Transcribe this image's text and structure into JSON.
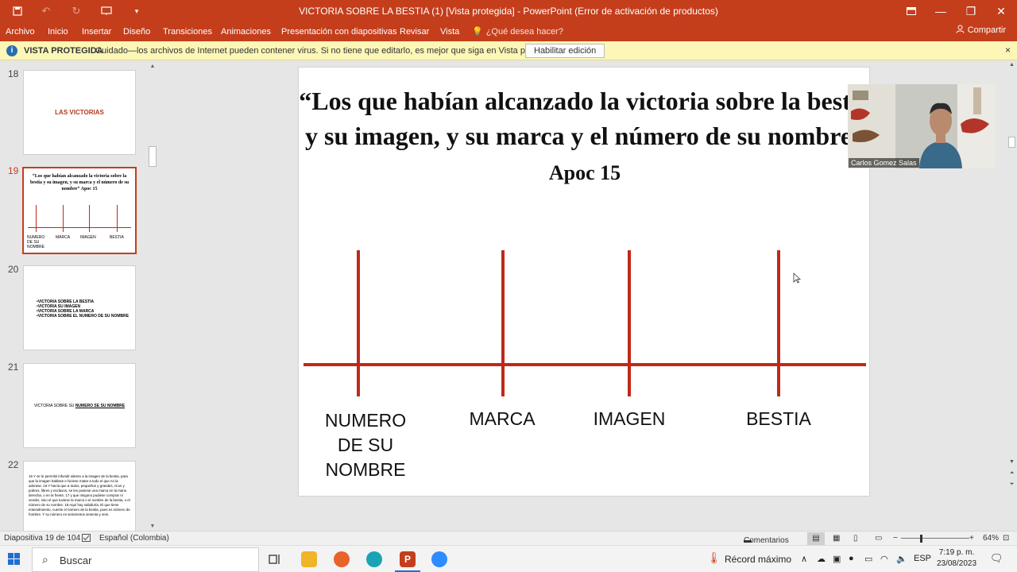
{
  "window": {
    "title": "VICTORIA SOBRE LA BESTIA (1) [Vista protegida] - PowerPoint (Error de activación de productos)"
  },
  "ribbon": {
    "tabs": [
      "Archivo",
      "Inicio",
      "Insertar",
      "Diseño",
      "Transiciones",
      "Animaciones",
      "Presentación con diapositivas",
      "Revisar",
      "Vista"
    ],
    "tell_me": "¿Qué desea hacer?",
    "share": "Compartir"
  },
  "protected_view": {
    "label": "VISTA PROTEGIDA",
    "message": "Cuidado—los archivos de Internet pueden contener virus. Si no tiene que editarlo, es mejor que siga en Vista protegida.",
    "enable_button": "Habilitar edición",
    "close": "×"
  },
  "thumbnails": {
    "numbers": [
      "18",
      "19",
      "20",
      "21",
      "22"
    ],
    "slide18_title": "LAS VICTORIAS",
    "slide19_title": "“Los que habían alcanzado la victoria sobre la bestia y su imagen, y su marca y el número de su nombre” Apoc 15",
    "slide19_labels": [
      "NUMERO DE SU NOMBRE",
      "MARCA",
      "IMAGEN",
      "BESTIA"
    ],
    "slide20_lines": [
      "•VICTORIA SOBRE LA BESTIA",
      "•VICTORIA SU IMAGEN",
      "•VICTORIA SOBRE LA MARCA",
      "•VICTORIA SOBRE EL NUMERO DE SU NOMBRE"
    ],
    "slide21_text": "VICTORIA SOBRE SU",
    "slide21_underlined": "NUMERO SE SU NOMBRE",
    "slide22_text": "16 Y se le permitió infundir aliento a la imagen de la bestia, para que la imagen hablase e hiciese matar a todo el que no la adorase. 16 Y hacía que a todos, pequeños y grandes, ricos y pobres, libres y esclavos, se les pusiese una marca en la mano derecha, o en la frente; 17 y que ninguno pudiese comprar ni vender, sino el que tuviese la marca o el nombre de la bestia, o el número de su nombre. 18 Aquí hay sabiduría. El que tiene entendimiento, cuente el número de la bestia, pues es número de hombre. Y su número es seiscientos sesenta y seis."
  },
  "slide": {
    "title_main": "“Los que habían alcanzado la victoria sobre la bestia y su imagen, y su marca y el número de su nombre”",
    "title_ref": "Apoc 15",
    "labels": {
      "numero": "NUMERO DE SU NOMBRE",
      "marca": "MARCA",
      "imagen": "IMAGEN",
      "bestia": "BESTIA"
    }
  },
  "video": {
    "participant_name": "Carlos Gomez Salas"
  },
  "status_bar": {
    "slide_info": "Diapositiva 19 de 104",
    "language": "Español (Colombia)",
    "comments": "Comentarios",
    "zoom": "64%"
  },
  "taskbar": {
    "search_placeholder": "Buscar",
    "weather": "Récord máximo",
    "language": "ESP",
    "time": "7:19 p. m.",
    "date": "23/08/2023"
  },
  "colors": {
    "accent": "#c43e1c",
    "slide_line": "#c0291a",
    "protected_bar": "#fcf7b6"
  }
}
